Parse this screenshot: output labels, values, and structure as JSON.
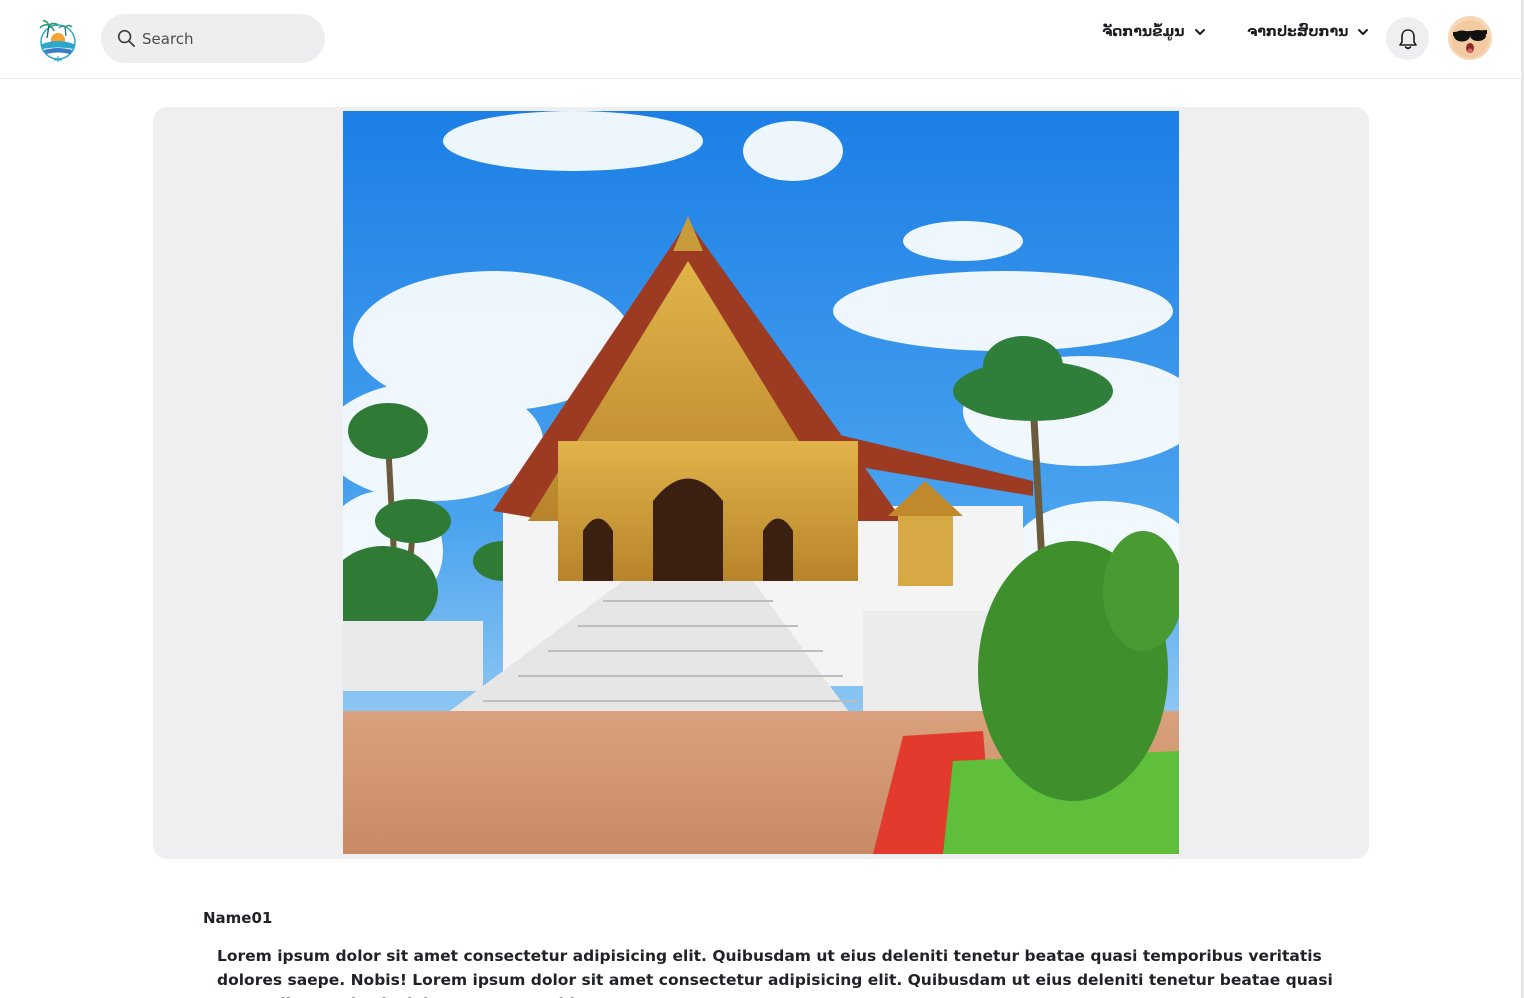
{
  "header": {
    "logo": "beach-island-logo",
    "search": {
      "placeholder": "Search",
      "value": "",
      "icon": "search-icon"
    },
    "menus": [
      {
        "label": "ຈັດການຂໍ້ມູນ",
        "icon": "chevron-down-icon"
      },
      {
        "label": "ຈາກປະສົບການ",
        "icon": "chevron-down-icon"
      }
    ],
    "notification_icon": "bell-icon",
    "avatar": "sunglasses-emoji-avatar"
  },
  "hero": {
    "image": "temple-photo",
    "colors": {
      "frame": "#efeff1",
      "sky": "#2f8fe8"
    }
  },
  "content": {
    "name": "Name01",
    "description": "Lorem ipsum dolor sit amet consectetur adipisicing elit. Quibusdam ut eius deleniti tenetur beatae quasi temporibus veritatis dolores saepe. Nobis! Lorem ipsum dolor sit amet consectetur adipisicing elit. Quibusdam ut eius deleniti tenetur beatae quasi temporibus veritatis dolores saepe. Nobis!"
  }
}
